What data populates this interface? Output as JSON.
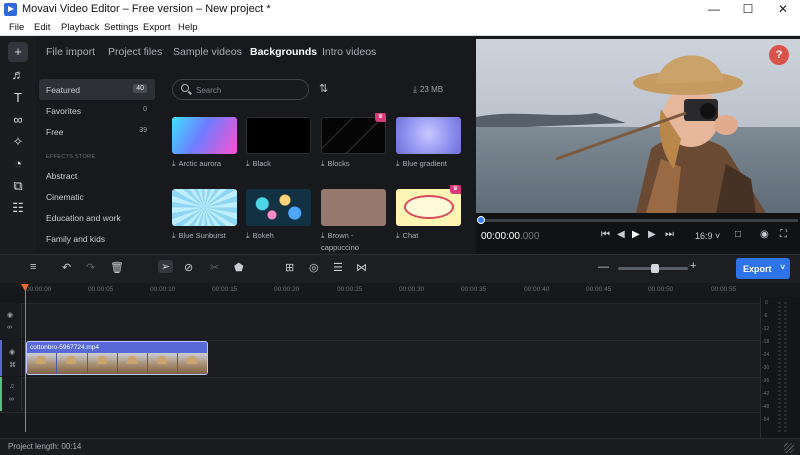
{
  "window": {
    "title": "Movavi Video Editor – Free version – New project *",
    "minimize": "—",
    "maximize": "☐",
    "close": "✕"
  },
  "menu": [
    "File",
    "Edit",
    "Playback",
    "Settings",
    "Export",
    "Help"
  ],
  "tools": [
    {
      "icon": "plus-icon",
      "glyph": "+"
    },
    {
      "icon": "music-icon",
      "glyph": "♬"
    },
    {
      "icon": "text-icon",
      "glyph": "T"
    },
    {
      "icon": "transitions-icon",
      "glyph": "∞"
    },
    {
      "icon": "magic-wand-icon",
      "glyph": "✧"
    },
    {
      "icon": "sticker-icon",
      "glyph": "◔"
    },
    {
      "icon": "camera-icon",
      "glyph": "⧉"
    },
    {
      "icon": "more-tools-icon",
      "glyph": "☷"
    }
  ],
  "media_tabs": [
    {
      "label": "File import",
      "active": false
    },
    {
      "label": "Project files",
      "active": false
    },
    {
      "label": "Sample videos",
      "active": false
    },
    {
      "label": "Backgrounds",
      "active": true
    },
    {
      "label": "Intro videos",
      "active": false
    }
  ],
  "categories": [
    {
      "label": "Featured",
      "count": "40",
      "active": true
    },
    {
      "label": "Favorites",
      "count": "0",
      "active": false
    },
    {
      "label": "Free",
      "count": "39",
      "active": false
    }
  ],
  "effects_store_heading": "EFFECTS STORE",
  "store_categories": [
    "Abstract",
    "Cinematic",
    "Education and work",
    "Family and kids"
  ],
  "search": {
    "placeholder": "Search"
  },
  "download_size": "23 MB",
  "backgrounds": [
    {
      "label": "Arctic aurora",
      "premium": false
    },
    {
      "label": "Black",
      "premium": false
    },
    {
      "label": "Blocks",
      "premium": true
    },
    {
      "label": "Blue gradient",
      "premium": false
    },
    {
      "label": "Blue Sunburst",
      "premium": false
    },
    {
      "label": "Bokeh",
      "premium": false
    },
    {
      "label": "Brown - cappuccino",
      "premium": false
    },
    {
      "label": "Chat",
      "premium": true
    }
  ],
  "preview": {
    "help": "?",
    "timecode_main": "00:00:00",
    "timecode_frac": ".000",
    "aspect": "16:9",
    "progress": 0
  },
  "toolbar": {
    "export_label": "Export"
  },
  "timeline": {
    "ticks": [
      "00:00:00",
      "00:00:05",
      "00:00:10",
      "00:00:15",
      "00:00:20",
      "00:00:25",
      "00:00:30",
      "00:00:35",
      "00:00:40",
      "00:00:45",
      "00:00:50",
      "00:00:55"
    ],
    "clip_name": "cottonbro-5967724.mp4",
    "meter_labels": [
      "0",
      "-6",
      "-12",
      "-18",
      "-24",
      "-30",
      "-36",
      "-42",
      "-48",
      "-54"
    ]
  },
  "status": {
    "project_length": "Project length: 00:14"
  }
}
